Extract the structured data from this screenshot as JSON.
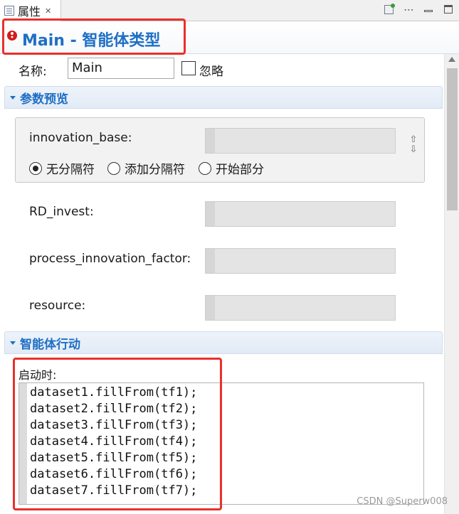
{
  "tab": {
    "label": "属性",
    "close": "✕"
  },
  "header": {
    "title": "Main - 智能体类型"
  },
  "name_row": {
    "label": "名称:",
    "value": "Main",
    "ignore_label": "忽略"
  },
  "sections": {
    "params": {
      "title": "参数预览"
    },
    "actions": {
      "title": "智能体行动"
    }
  },
  "params": {
    "innovation_base": {
      "label": "innovation_base:"
    },
    "radios": [
      {
        "label": "无分隔符",
        "selected": true
      },
      {
        "label": "添加分隔符",
        "selected": false
      },
      {
        "label": "开始部分",
        "selected": false
      }
    ],
    "rd_invest": {
      "label": "RD_invest:"
    },
    "process_innovation_factor": {
      "label": "process_innovation_factor:"
    },
    "resource": {
      "label": "resource:"
    }
  },
  "actions": {
    "on_startup_label": "启动时:",
    "code": [
      "dataset1.fillFrom(tf1);",
      "dataset2.fillFrom(tf2);",
      "dataset3.fillFrom(tf3);",
      "dataset4.fillFrom(tf4);",
      "dataset5.fillFrom(tf5);",
      "dataset6.fillFrom(tf6);",
      "dataset7.fillFrom(tf7);"
    ]
  },
  "watermark": "CSDN @Superw008",
  "colors": {
    "accent": "#1f6fc5",
    "highlight": "#e8312b",
    "error_icon": "#d41b1b"
  }
}
